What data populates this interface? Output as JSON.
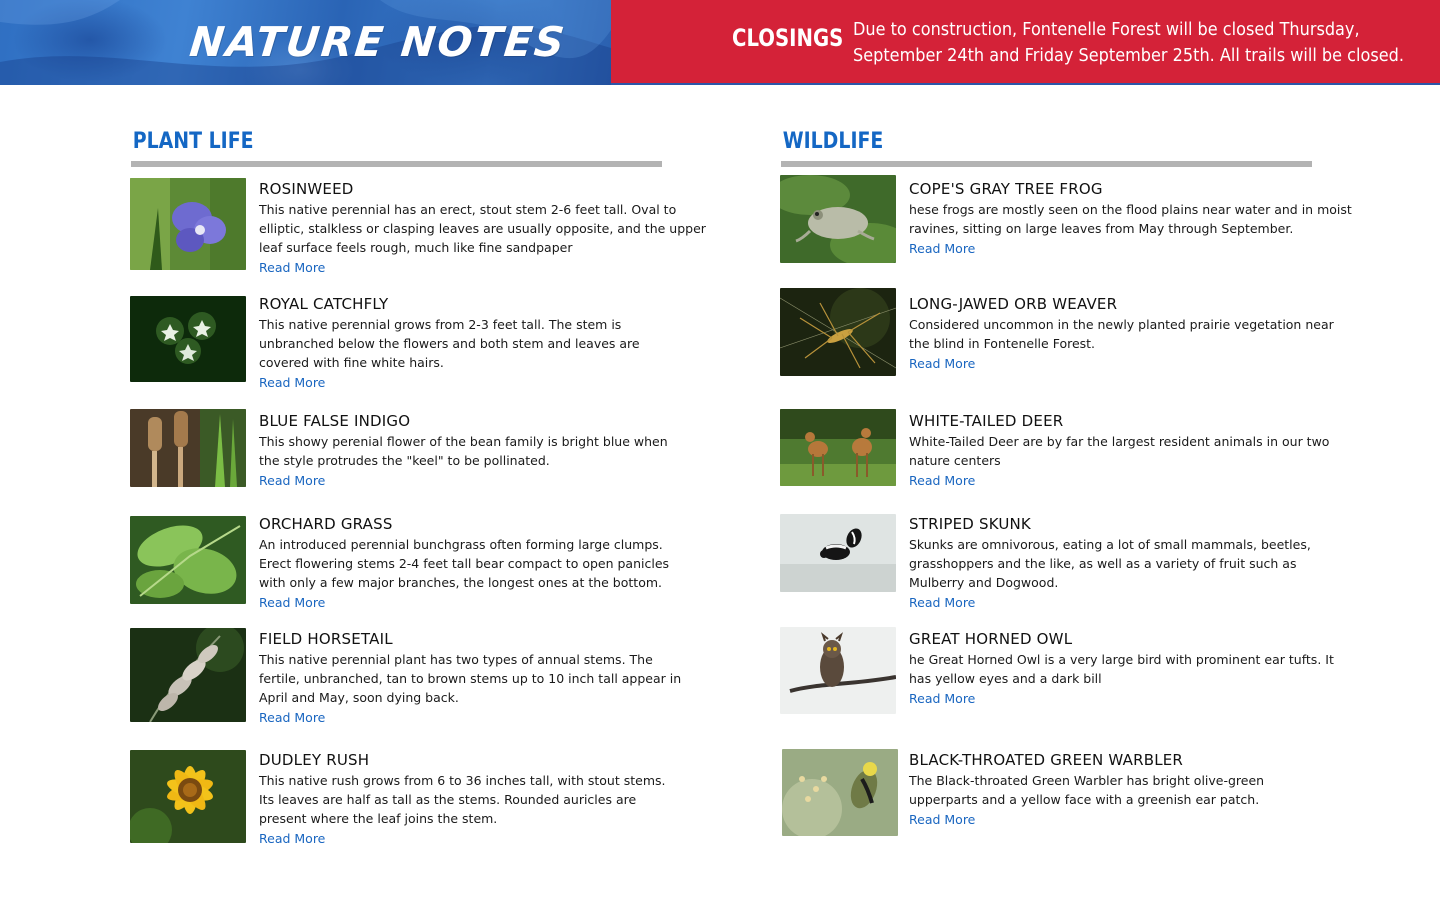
{
  "header": {
    "title": "NATURE NOTES",
    "closings_label": "CLOSINGS",
    "closings_lines": [
      "Due to construction, Fontenelle Forest will be closed Thursday,",
      "September 24th and Friday September 25th. All trails will be closed."
    ],
    "colors": {
      "hero": "#2f6fc2",
      "closings": "#d42238",
      "accent_blue": "#1467c4",
      "link": "#1a66c0",
      "rule": "#b3b3b3"
    }
  },
  "plant_life": {
    "title": "PLANT LIFE",
    "items": [
      {
        "name": "ROSINWEED",
        "desc_lines": [
          "This native perennial has an erect, stout stem 2-6 feet tall. Oval to",
          "elliptic, stalkless or clasping leaves are usually opposite, and the upper",
          "leaf surface feels rough, much like fine sandpaper"
        ],
        "link": "Read More",
        "image": "violet-flower-photo"
      },
      {
        "name": "ROYAL CATCHFLY",
        "desc_lines": [
          "This native perennial grows from 2-3 feet tall.  The stem is",
          "unbranched below the flowers and both stem and leaves are",
          "covered with fine white hairs."
        ],
        "link": "Read More",
        "image": "white-star-flowers-photo"
      },
      {
        "name": "BLUE FALSE INDIGO",
        "desc_lines": [
          "This showy perenial flower of the bean family is bright blue when",
          "the style protrudes the \"keel\" to be pollinated."
        ],
        "link": "Read More",
        "image": "horsetail-cones-photo"
      },
      {
        "name": "ORCHARD GRASS",
        "desc_lines": [
          "An introduced perennial bunchgrass often forming large clumps.",
          "Erect flowering stems 2-4 feet tall bear compact to open panicles",
          "with only a few major branches, the longest ones at the bottom."
        ],
        "link": "Read More",
        "image": "green-leaves-photo"
      },
      {
        "name": "FIELD HORSETAIL",
        "desc_lines": [
          "This native perennial plant has two types of annual stems. The",
          "fertile, unbranched, tan to brown stems up to 10 inch tall appear in",
          "April and May, soon dying back."
        ],
        "link": "Read More",
        "image": "grass-panicle-photo"
      },
      {
        "name": "DUDLEY RUSH",
        "desc_lines": [
          "This native rush grows from 6 to 36 inches tall, with stout stems.",
          "Its leaves are half as tall as the stems. Rounded auricles are",
          "present where the leaf joins the stem."
        ],
        "link": "Read More",
        "image": "yellow-sunflower-photo"
      }
    ]
  },
  "wildlife": {
    "title": "WILDLIFE",
    "items": [
      {
        "name": "COPE'S GRAY TREE FROG",
        "desc_lines": [
          "hese frogs are mostly seen on the flood plains near water and in moist",
          "ravines, sitting on large leaves from May through September."
        ],
        "link": "Read More",
        "image": "tree-frog-photo"
      },
      {
        "name": "LONG-JAWED ORB WEAVER",
        "desc_lines": [
          "Considered uncommon in the newly planted prairie vegetation near",
          "the blind in Fontenelle Forest."
        ],
        "link": "Read More",
        "image": "spider-photo"
      },
      {
        "name": "WHITE-TAILED DEER",
        "desc_lines": [
          "White-Tailed Deer are by far the largest resident animals in our two",
          "nature centers"
        ],
        "link": "Read More",
        "image": "fawns-photo"
      },
      {
        "name": "STRIPED SKUNK",
        "desc_lines": [
          "Skunks are omnivorous, eating a lot of small mammals, beetles,",
          "grasshoppers and the like, as well as a variety of fruit such as",
          "Mulberry and Dogwood."
        ],
        "link": "Read More",
        "image": "skunk-photo"
      },
      {
        "name": "GREAT HORNED OWL",
        "desc_lines": [
          "he Great Horned Owl is a very large bird with prominent ear tufts. It",
          "has yellow eyes and a dark bill"
        ],
        "link": "Read More",
        "image": "owl-photo"
      },
      {
        "name": "BLACK-THROATED GREEN WARBLER",
        "desc_lines": [
          "The Black-throated Green Warbler has bright olive-green",
          "upperparts and a yellow face with a greenish ear patch."
        ],
        "link": "Read More",
        "image": "warbler-photo"
      }
    ]
  }
}
